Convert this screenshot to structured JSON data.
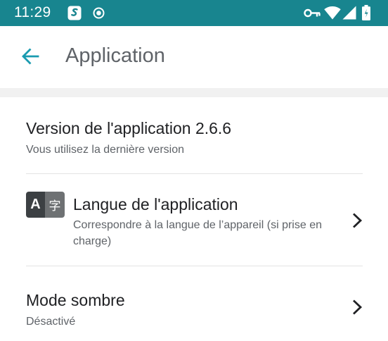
{
  "status_bar": {
    "time": "11:29",
    "icons": [
      "app-s-icon",
      "record-icon",
      "vpn-key-icon",
      "wifi-icon",
      "signal-icon",
      "battery-icon"
    ],
    "background_color": "#18858f"
  },
  "app_bar": {
    "title": "Application",
    "back_icon": "arrow-back-icon",
    "accent_color": "#1a9bb0"
  },
  "settings": {
    "version": {
      "title": "Version de l'application 2.6.6",
      "subtitle": "Vous utilisez la dernière version"
    },
    "language": {
      "icon_latin": "A",
      "icon_cjk": "字",
      "title": "Langue de l'application",
      "subtitle": "Correspondre à la langue de l’appareil (si prise en charge)"
    },
    "dark_mode": {
      "title": "Mode sombre",
      "subtitle": "Désactivé"
    }
  }
}
